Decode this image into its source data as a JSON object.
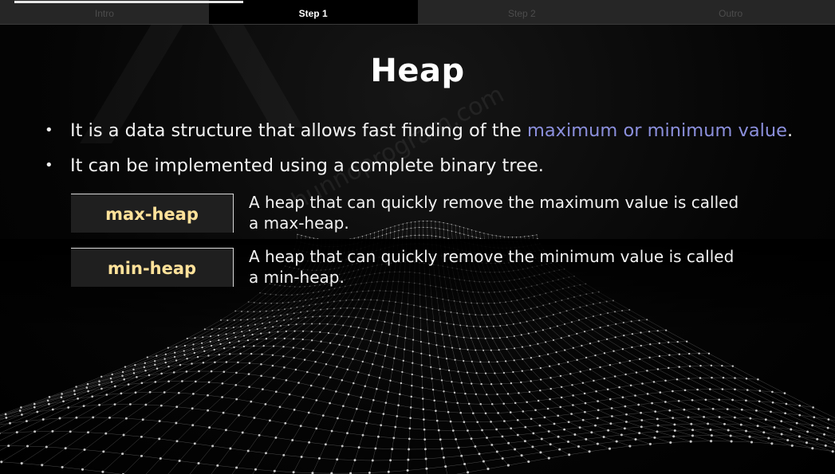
{
  "tabs": [
    {
      "label": "Intro",
      "active": false
    },
    {
      "label": "Step 1",
      "active": true
    },
    {
      "label": "Step 2",
      "active": false
    },
    {
      "label": "Outro",
      "active": false
    }
  ],
  "title": "Heap",
  "bullets": [
    {
      "text_before": "It is a data structure that allows fast finding of the ",
      "highlight": "maximum or minimum value",
      "text_after": "."
    },
    {
      "text_before": "It can be implemented using a complete binary tree.",
      "highlight": "",
      "text_after": ""
    }
  ],
  "terms": [
    {
      "label": "max-heap",
      "line1": "A heap that can quickly remove the maximum value is called",
      "line2": "a max-heap."
    },
    {
      "label": "min-heap",
      "line1": "A heap that can quickly remove the minimum value is called",
      "line2": "a min-heap."
    }
  ],
  "watermark": "hunnoprogram.com",
  "colors": {
    "highlight": "#8b8fdc",
    "term_label": "#ffe29a",
    "background": "#000000"
  }
}
